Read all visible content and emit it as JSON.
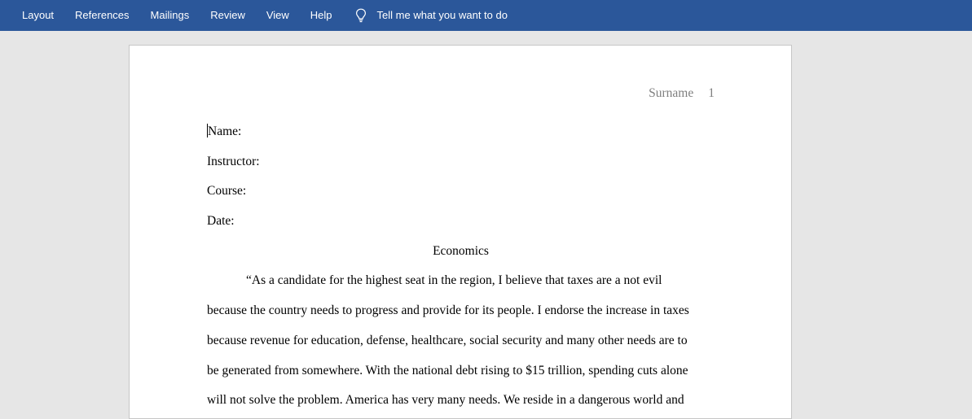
{
  "ribbon": {
    "tabs": [
      "Layout",
      "References",
      "Mailings",
      "Review",
      "View",
      "Help"
    ],
    "tellme_icon": "lightbulb-icon",
    "tellme_label": "Tell me what you want to do",
    "color": "#2b579a"
  },
  "document": {
    "header": {
      "surname": "Surname",
      "page_number": "1"
    },
    "fields": {
      "name": "Name:",
      "instructor": "Instructor:",
      "course": "Course:",
      "date": "Date:"
    },
    "title": "Economics",
    "paragraph_lines": [
      "“As a candidate for the highest seat in the region, I believe that taxes are a not evil",
      "because the country needs to progress and provide for its people. I endorse the increase in taxes",
      "because revenue for education, defense, healthcare, social security and many other needs are to",
      "be generated from somewhere. With the national debt rising to $15 trillion, spending cuts alone",
      "will not solve the problem. America has very many needs. We reside in a dangerous world and"
    ]
  }
}
